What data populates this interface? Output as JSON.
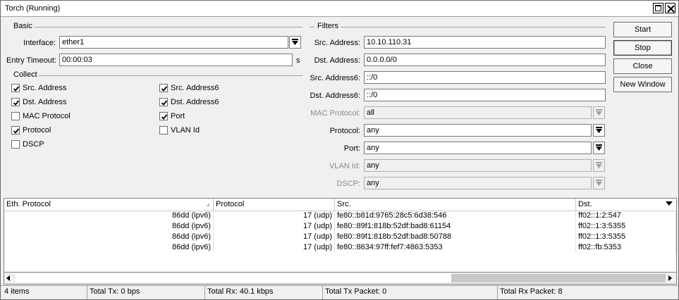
{
  "window": {
    "title": "Torch (Running)"
  },
  "basic": {
    "section_label": "Basic",
    "interface_label": "Interface:",
    "interface_value": "ether1",
    "entry_timeout_label": "Entry Timeout:",
    "entry_timeout_value": "00:00:03",
    "entry_timeout_unit": "s"
  },
  "collect": {
    "section_label": "Collect",
    "items": [
      {
        "label": "Src. Address",
        "checked": true
      },
      {
        "label": "Dst. Address",
        "checked": true
      },
      {
        "label": "MAC Protocol",
        "checked": false
      },
      {
        "label": "Protocol",
        "checked": true
      },
      {
        "label": "DSCP",
        "checked": false
      },
      {
        "label": "Src. Address6",
        "checked": true
      },
      {
        "label": "Dst. Address6",
        "checked": true
      },
      {
        "label": "Port",
        "checked": true
      },
      {
        "label": "VLAN Id",
        "checked": false
      }
    ]
  },
  "filters": {
    "section_label": "Filters",
    "src_address_label": "Src. Address:",
    "src_address_value": "10.10.110.31",
    "dst_address_label": "Dst. Address:",
    "dst_address_value": "0.0.0.0/0",
    "src_address6_label": "Src. Address6:",
    "src_address6_value": "::/0",
    "dst_address6_label": "Dst. Address6:",
    "dst_address6_value": "::/0",
    "mac_protocol_label": "MAC Protocol:",
    "mac_protocol_value": "all",
    "protocol_label": "Protocol:",
    "protocol_value": "any",
    "port_label": "Port:",
    "port_value": "any",
    "vlan_id_label": "VLAN Id:",
    "vlan_id_value": "any",
    "dscp_label": "DSCP:",
    "dscp_value": "any"
  },
  "buttons": {
    "start": "Start",
    "stop": "Stop",
    "close": "Close",
    "new_window": "New Window"
  },
  "table": {
    "columns": [
      "Eth. Protocol",
      "Protocol",
      "Src.",
      "Dst."
    ],
    "rows": [
      [
        "86dd (ipv6)",
        "17 (udp)",
        "fe80::b81d:9765:28c5:6d38:546",
        "ff02::1:2:547"
      ],
      [
        "86dd (ipv6)",
        "17 (udp)",
        "fe80::89f1:818b:52df:bad8:61154",
        "ff02::1:3:5355"
      ],
      [
        "86dd (ipv6)",
        "17 (udp)",
        "fe80::89f1:818b:52df:bad8:50788",
        "ff02::1:3:5355"
      ],
      [
        "86dd (ipv6)",
        "17 (udp)",
        "fe80::8634:97ff:fef7:4863:5353",
        "ff02::fb:5353"
      ]
    ]
  },
  "status": {
    "items_count": "4 items",
    "total_tx": "Total Tx: 0 bps",
    "total_rx": "Total Rx: 40.1 kbps",
    "total_tx_packet": "Total Tx Packet: 0",
    "total_rx_packet": "Total Rx Packet: 8"
  }
}
